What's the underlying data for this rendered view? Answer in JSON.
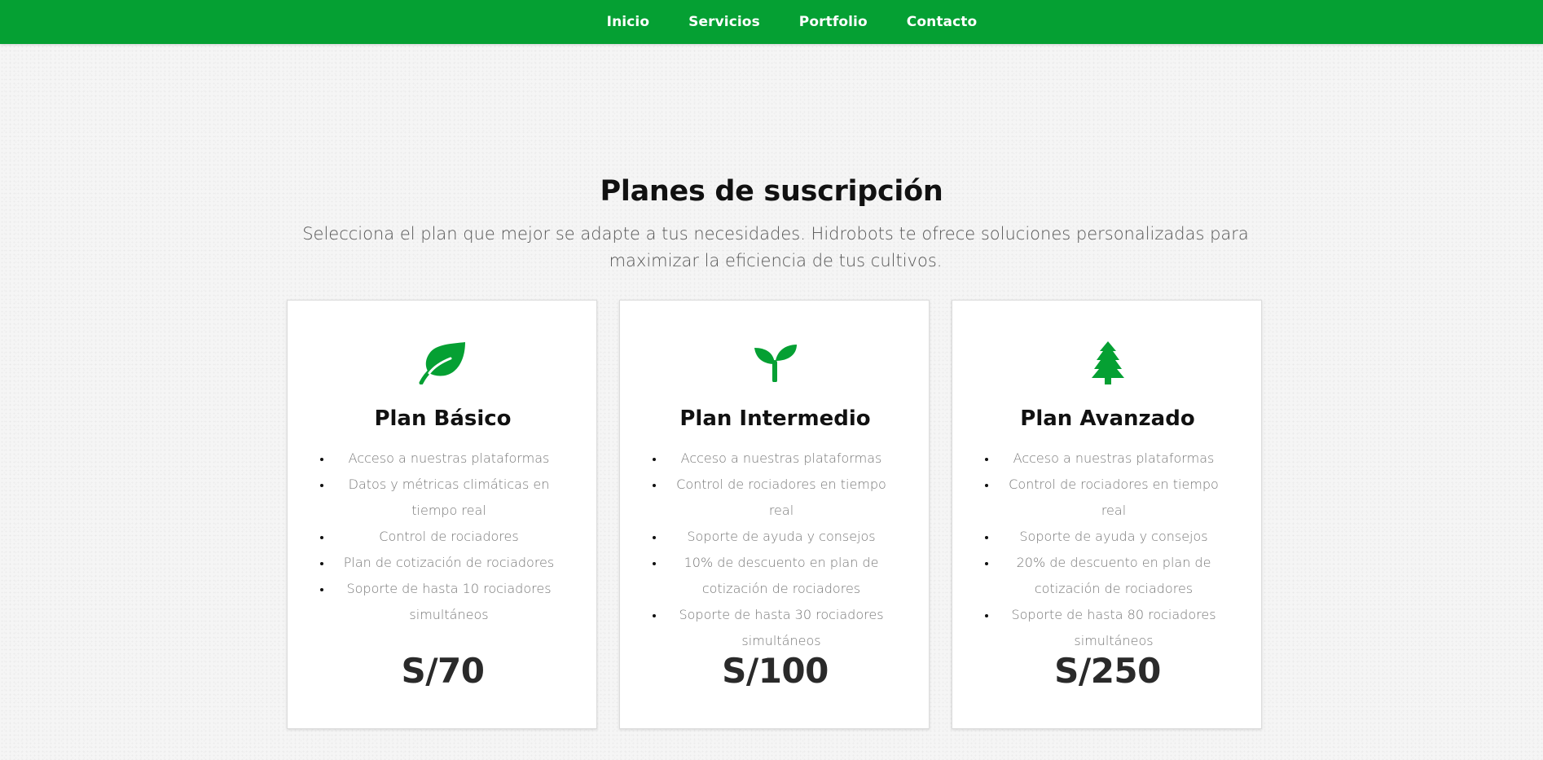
{
  "nav": {
    "items": [
      {
        "label": "Inicio"
      },
      {
        "label": "Servicios"
      },
      {
        "label": "Portfolio"
      },
      {
        "label": "Contacto"
      }
    ]
  },
  "section": {
    "title": "Planes de suscripción",
    "subtitle": "Selecciona el plan que mejor se adapte a tus necesidades. Hidrobots te ofrece soluciones personalizadas para maximizar la eficiencia de tus cultivos."
  },
  "colors": {
    "brand_green": "#05a033",
    "card_bg": "#ffffff",
    "price_text": "#2a2a2a"
  },
  "plans": [
    {
      "icon": "leaf-icon",
      "name": "Plan Básico",
      "features": [
        "Acceso a nuestras plataformas",
        "Datos y métricas climáticas en tiempo real",
        "Control de rociadores",
        "Plan de cotización de rociadores",
        "Soporte de hasta 10 rociadores simultáneos"
      ],
      "price": "S/70"
    },
    {
      "icon": "seedling-icon",
      "name": "Plan Intermedio",
      "features": [
        "Acceso a nuestras plataformas",
        "Control de rociadores en tiempo real",
        "Soporte de ayuda y consejos",
        "10% de descuento en plan de cotización de rociadores",
        "Soporte de hasta 30 rociadores simultáneos"
      ],
      "price": "S/100"
    },
    {
      "icon": "tree-icon",
      "name": "Plan Avanzado",
      "features": [
        "Acceso a nuestras plataformas",
        "Control de rociadores en tiempo real",
        "Soporte de ayuda y consejos",
        "20% de descuento en plan de cotización de rociadores",
        "Soporte de hasta 80 rociadores simultáneos"
      ],
      "price": "S/250"
    }
  ]
}
